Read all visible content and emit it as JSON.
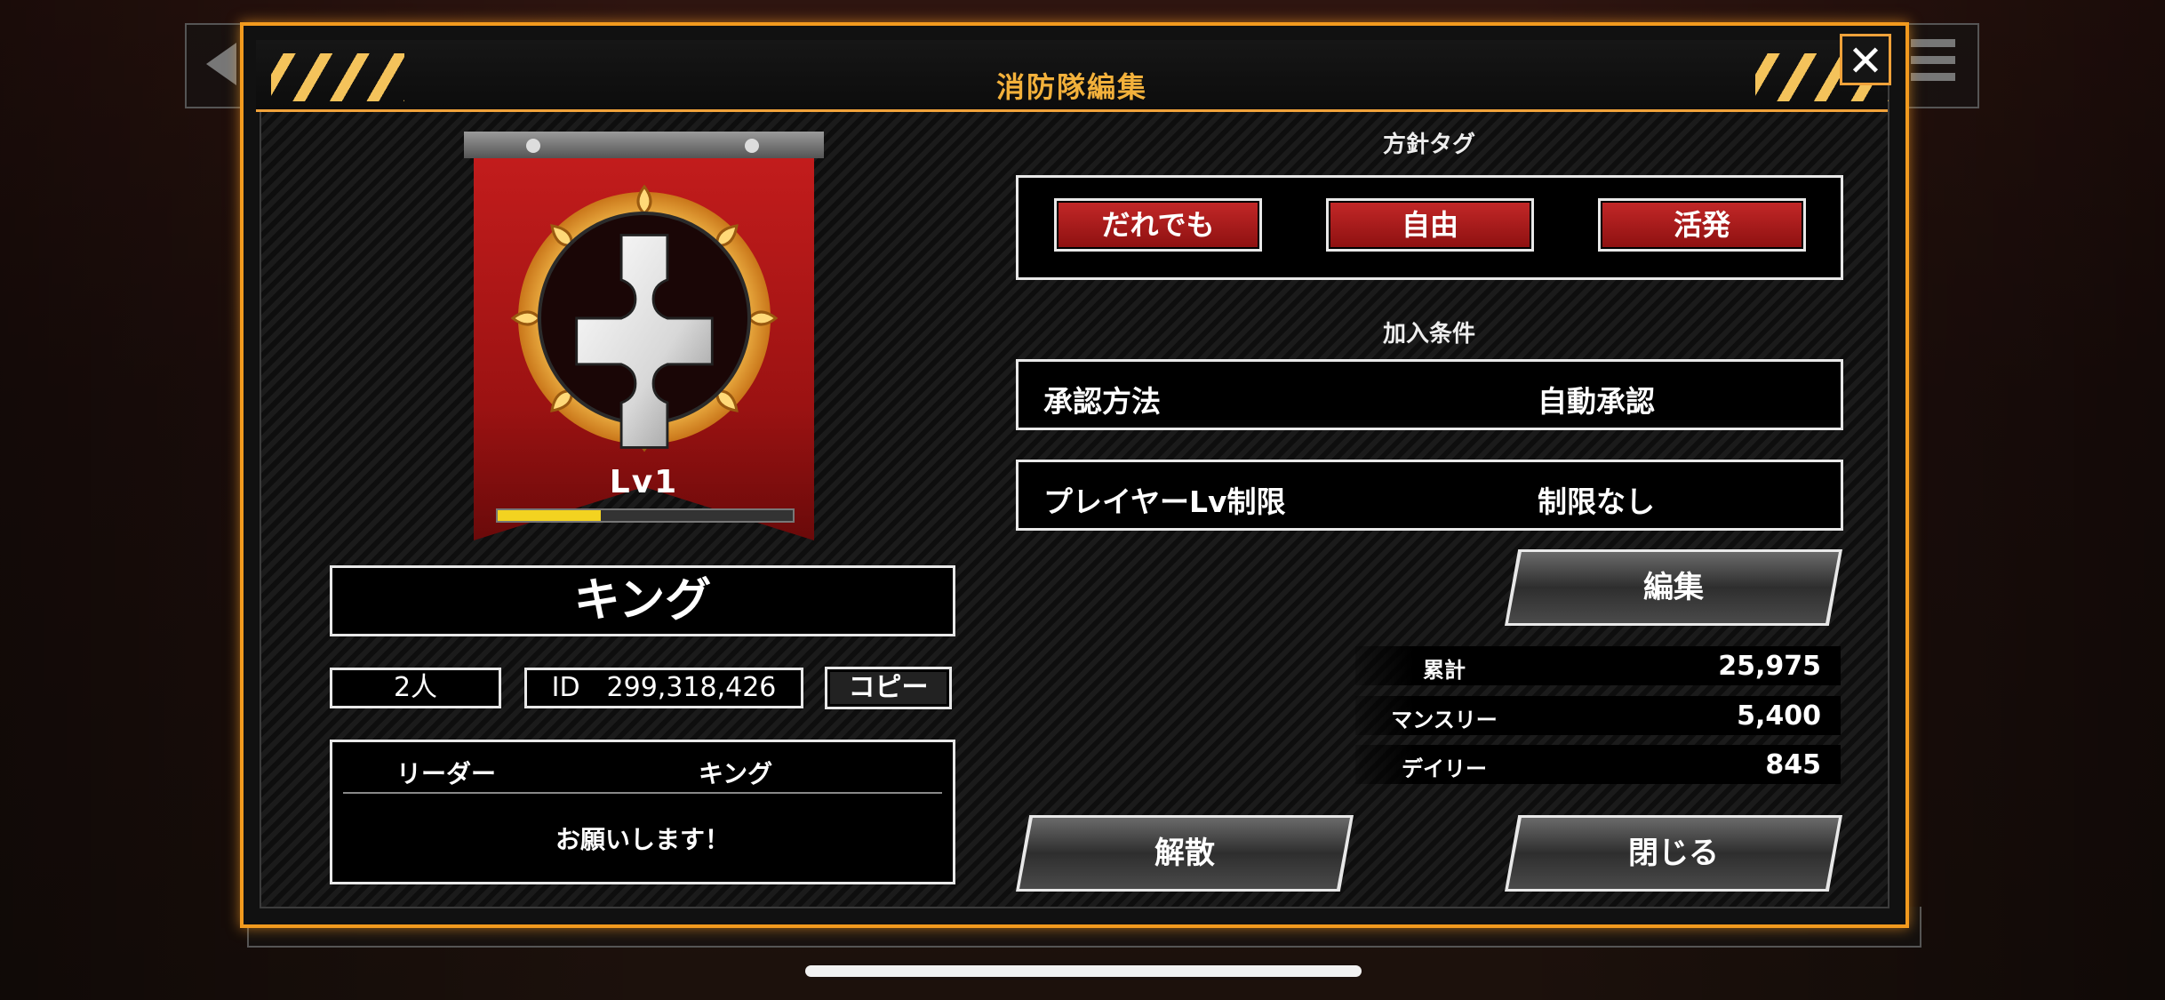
{
  "header": {
    "title": "消防隊編集"
  },
  "banner": {
    "level_label": "Lv1",
    "exp_progress": 0.35,
    "emblem": "cross-emblem-icon"
  },
  "team": {
    "name": "キング",
    "member_count": "2人",
    "id_text": "ID　299,318,426",
    "copy_label": "コピー",
    "leader_label": "リーダー",
    "leader_name": "キング",
    "message": "お願いします！"
  },
  "policy": {
    "section_label": "方針タグ",
    "tags": [
      "だれでも",
      "自由",
      "活発"
    ]
  },
  "conditions": {
    "section_label": "加入条件",
    "approval_label": "承認方法",
    "approval_value": "自動承認",
    "level_limit_label": "プレイヤーLv制限",
    "level_limit_value": "制限なし"
  },
  "buttons": {
    "edit": "編集",
    "disband": "解散",
    "close": "閉じる"
  },
  "stats": [
    {
      "label": "累計",
      "value": "25,975"
    },
    {
      "label": "マンスリー",
      "value": "5,400"
    },
    {
      "label": "デイリー",
      "value": "845"
    }
  ],
  "colors": {
    "accent_orange": "#f29a1e",
    "tag_red": "#b21a1a",
    "gold": "#f3b13b"
  }
}
